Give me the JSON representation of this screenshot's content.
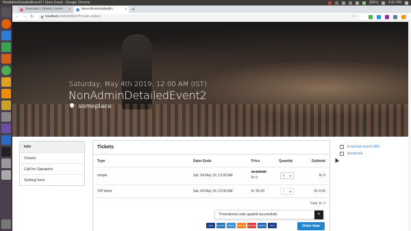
{
  "os_bar": {
    "window_title": "NonAdminDetailedEvent2 | Open Event - Google Chrome",
    "battery": "(82%)",
    "clock": "6:01 PM"
  },
  "browser": {
    "tabs": [
      {
        "title": "Overview | Tickets | NonA"
      },
      {
        "title": "NonAdminDetailedEv"
      }
    ],
    "new_tab": "+",
    "back": "←",
    "forward": "→",
    "reload": "↻",
    "url_host": "localhost",
    "url_path": ":4200/e/8f31f7f?code=Ab6cd",
    "menu": "⋮",
    "star": "☆",
    "tab_close": "×"
  },
  "hero": {
    "date": "Saturday, May 4th 2019, 12:00 AM (IST)",
    "title": "NonAdminDetailedEvent2",
    "location": "someplace"
  },
  "sidebar": {
    "items": [
      {
        "label": "Info"
      },
      {
        "label": "Tickets"
      },
      {
        "label": "Call for Speakers"
      },
      {
        "label": "Getting here"
      }
    ]
  },
  "tickets": {
    "heading": "Tickets",
    "columns": {
      "type": "Type",
      "sales_ends": "Sales Ends",
      "price": "Price",
      "quantity": "Quantity",
      "subtotal": "Subtotal"
    },
    "rows": [
      {
        "type": "simple",
        "sales_ends": "Sat, 04 May 19, 12:00 AM",
        "price_original": "Kr 100.00",
        "price": "Kr 0",
        "quantity": "1",
        "subtotal": "Kr 0"
      },
      {
        "type": "VIP ticket",
        "sales_ends": "Sat, 04 May 19, 12:00 AM",
        "price": "Kr 25.00",
        "quantity": "0",
        "subtotal": "Kr 0.00"
      }
    ],
    "total": "Total: Kr 0",
    "promo_message": "Promotional code applied successfully",
    "promo_close": "×",
    "payment_methods": [
      "Visa Electron",
      "American Express",
      "Diners Club",
      "Discover",
      "Mastercard",
      "PayPal",
      "Visa"
    ],
    "order_button": "Order Now"
  },
  "right_links": {
    "external_event_url": "External event URL",
    "facebook": "facebook"
  },
  "colors": {
    "accent": "#2185d0",
    "link": "#4183c4",
    "launcher": "#4a3f4c",
    "topbar": "#3c3b37"
  }
}
